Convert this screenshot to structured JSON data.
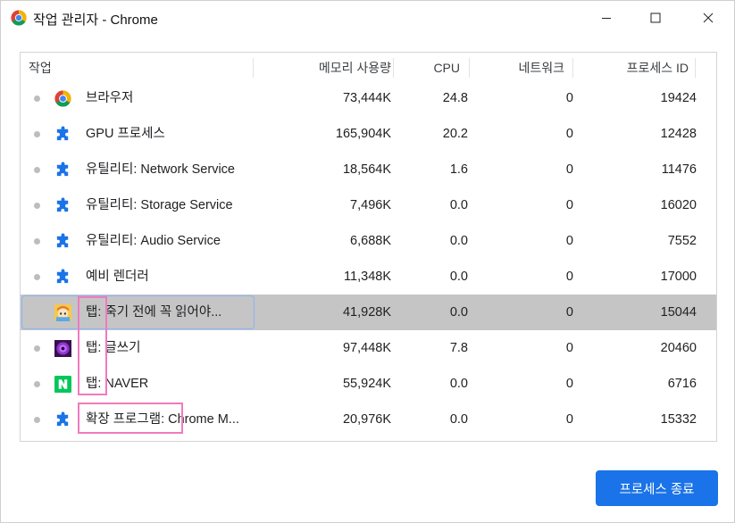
{
  "window": {
    "title": "작업 관리자 - Chrome",
    "controls": {
      "minimize": "minimize",
      "maximize": "maximize",
      "close": "close"
    }
  },
  "columns": {
    "task": "작업",
    "memory": "메모리 사용량",
    "cpu": "CPU",
    "network": "네트워크",
    "pid": "프로세스 ID"
  },
  "rows": [
    {
      "icon": "chrome-icon",
      "name": "브라우저",
      "memory": "73,444K",
      "cpu": "24.8",
      "network": "0",
      "pid": "19424",
      "selected": false
    },
    {
      "icon": "puzzle-icon",
      "name": "GPU 프로세스",
      "memory": "165,904K",
      "cpu": "20.2",
      "network": "0",
      "pid": "12428",
      "selected": false
    },
    {
      "icon": "puzzle-icon",
      "name": "유틸리티: Network Service",
      "memory": "18,564K",
      "cpu": "1.6",
      "network": "0",
      "pid": "11476",
      "selected": false
    },
    {
      "icon": "puzzle-icon",
      "name": "유틸리티: Storage Service",
      "memory": "7,496K",
      "cpu": "0.0",
      "network": "0",
      "pid": "16020",
      "selected": false
    },
    {
      "icon": "puzzle-icon",
      "name": "유틸리티: Audio Service",
      "memory": "6,688K",
      "cpu": "0.0",
      "network": "0",
      "pid": "7552",
      "selected": false
    },
    {
      "icon": "puzzle-icon",
      "name": "예비 렌더러",
      "memory": "11,348K",
      "cpu": "0.0",
      "network": "0",
      "pid": "17000",
      "selected": false
    },
    {
      "icon": "cartoon-favicon-icon",
      "name": "탭: 죽기 전에 꼭 읽어야...",
      "memory": "41,928K",
      "cpu": "0.0",
      "network": "0",
      "pid": "15044",
      "selected": true
    },
    {
      "icon": "purple-flower-favicon-icon",
      "name": "탭: 글쓰기",
      "memory": "97,448K",
      "cpu": "7.8",
      "network": "0",
      "pid": "20460",
      "selected": false
    },
    {
      "icon": "naver-icon",
      "name": "탭: NAVER",
      "memory": "55,924K",
      "cpu": "0.0",
      "network": "0",
      "pid": "6716",
      "selected": false
    },
    {
      "icon": "puzzle-icon",
      "name": "확장 프로그램: Chrome M...",
      "memory": "20,976K",
      "cpu": "0.0",
      "network": "0",
      "pid": "15332",
      "selected": false
    }
  ],
  "end_process_button": "프로세스 종료",
  "colors": {
    "accent": "#1a73e8",
    "puzzle": "#1a73e8",
    "naver": "#03c75a",
    "selection": "#c5c5c5",
    "annotation": "#f07ac0"
  }
}
